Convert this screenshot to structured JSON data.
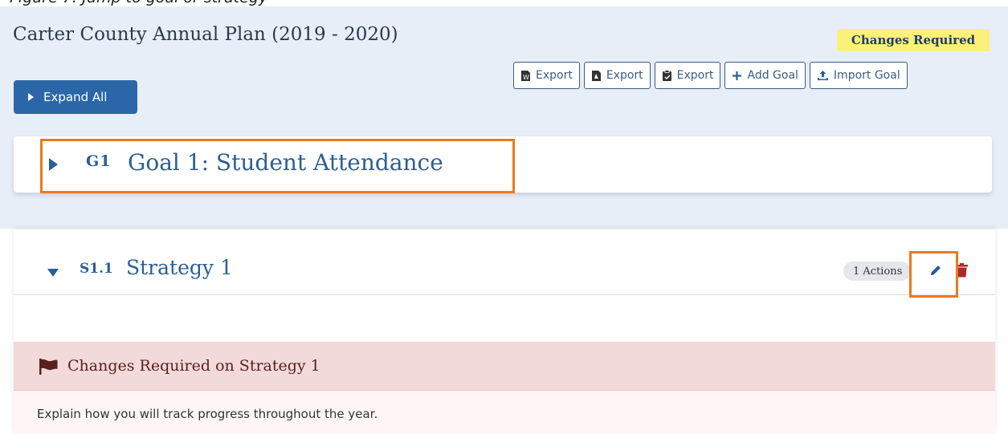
{
  "caption": "Figure 7: Jump to goal or strategy",
  "plan": {
    "title": "Carter County Annual Plan (2019 - 2020)",
    "status": "Changes Required"
  },
  "toolbar": {
    "buttons": [
      {
        "label": "Export",
        "icon": "word-doc-icon"
      },
      {
        "label": "Export",
        "icon": "pdf-doc-icon"
      },
      {
        "label": "Export",
        "icon": "clipboard-icon"
      },
      {
        "label": "Add Goal",
        "icon": "plus-icon"
      },
      {
        "label": "Import Goal",
        "icon": "upload-icon"
      }
    ]
  },
  "expand_all": {
    "label": "Expand All"
  },
  "goal": {
    "code": "G1",
    "title": "Goal 1: Student Attendance"
  },
  "strategy": {
    "code": "S1.1",
    "title": "Strategy 1",
    "actions_count": "1 Actions"
  },
  "alert": {
    "title": "Changes Required on Strategy 1",
    "body": "Explain how you will track progress throughout the year."
  },
  "colors": {
    "brand_blue": "#2b5f96",
    "button_blue": "#2b67a8",
    "badge_yellow": "#fbf07a",
    "highlight_orange": "#ec7a1c",
    "alert_red": "#f2dada",
    "trash_red": "#b0282a"
  }
}
